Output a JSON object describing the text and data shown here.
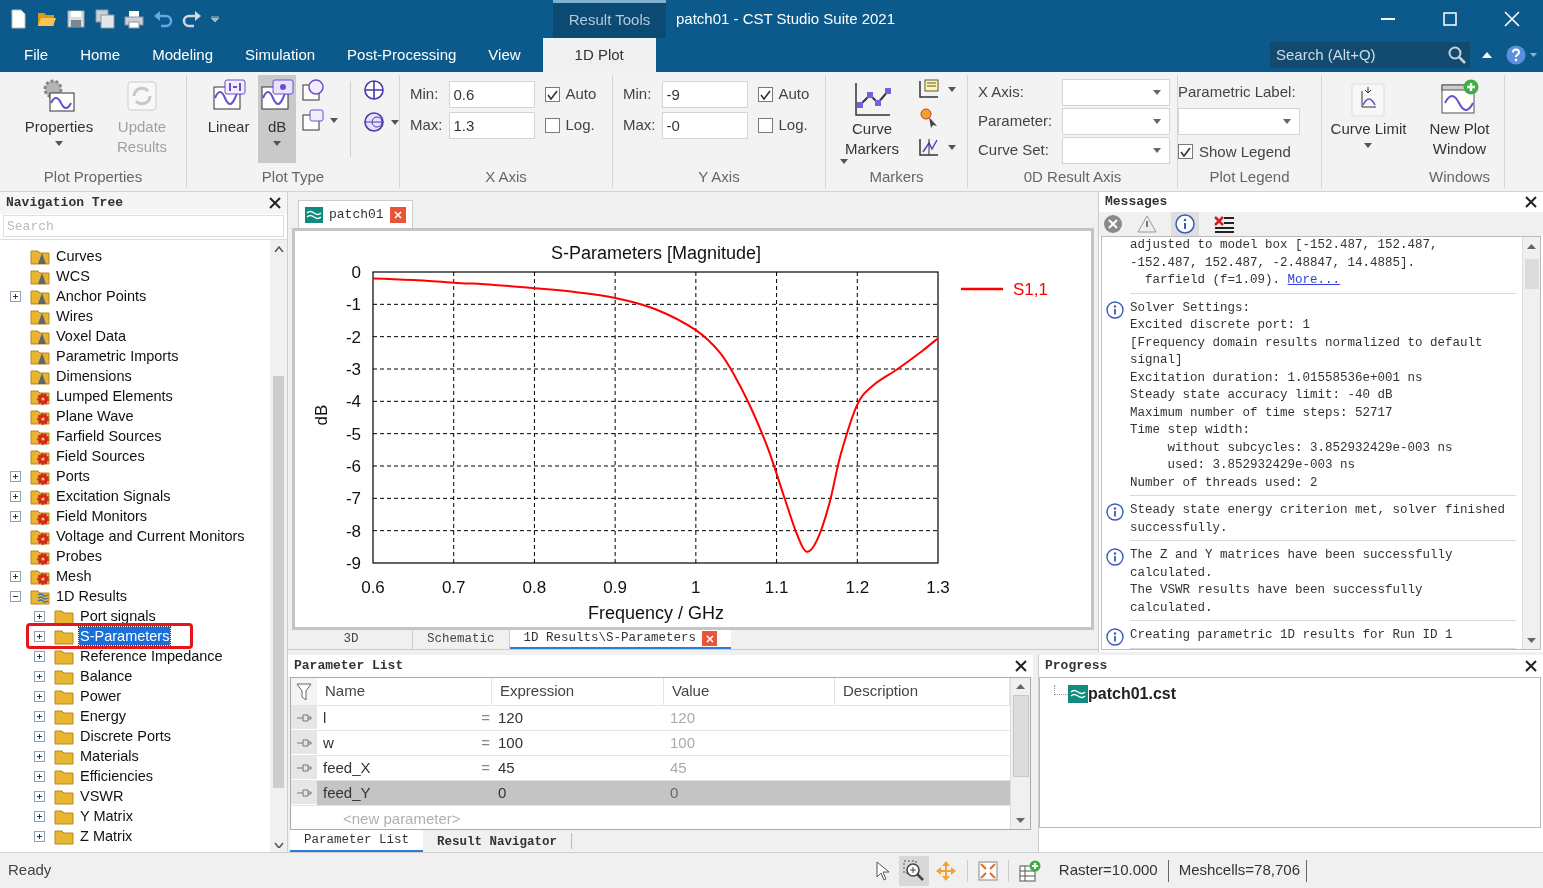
{
  "window": {
    "title": "patch01 - CST Studio Suite 2021",
    "context_tab": "Result Tools"
  },
  "ribbon_tabs": [
    {
      "label": "File",
      "selected": false
    },
    {
      "label": "Home",
      "selected": false
    },
    {
      "label": "Modeling",
      "selected": false
    },
    {
      "label": "Simulation",
      "selected": false
    },
    {
      "label": "Post-Processing",
      "selected": false
    },
    {
      "label": "View",
      "selected": false
    },
    {
      "label": "1D Plot",
      "selected": true
    }
  ],
  "search": {
    "placeholder": "Search (Alt+Q)"
  },
  "ribbon": {
    "plot_properties": {
      "label": "Plot Properties",
      "buttons": [
        {
          "label": "Properties",
          "disabled": false,
          "dropdown": true
        },
        {
          "label": "Update Results",
          "disabled": true,
          "dropdown": false
        }
      ]
    },
    "plot_type": {
      "label": "Plot Type",
      "buttons": [
        {
          "label": "Linear",
          "selected": false,
          "dropdown": false
        },
        {
          "label": "dB",
          "selected": true,
          "dropdown": true
        }
      ]
    },
    "x_axis": {
      "label": "X Axis",
      "min_label": "Min:",
      "min": "0.6",
      "max_label": "Max:",
      "max": "1.3",
      "auto": {
        "label": "Auto",
        "checked": true
      },
      "log": {
        "label": "Log.",
        "checked": false
      }
    },
    "y_axis": {
      "label": "Y Axis",
      "min_label": "Min:",
      "min": "-9",
      "max_label": "Max:",
      "max": "-0",
      "auto": {
        "label": "Auto",
        "checked": true
      },
      "log": {
        "label": "Log.",
        "checked": false
      }
    },
    "markers": {
      "label": "Markers",
      "button": "Curve Markers"
    },
    "result_axis": {
      "label": "0D Result Axis",
      "fields": [
        "X Axis:",
        "Parameter:",
        "Curve Set:"
      ]
    },
    "plot_legend": {
      "label": "Plot Legend",
      "parametric_label": "Parametric Label:",
      "show_legend": {
        "label": "Show Legend",
        "checked": true
      }
    },
    "curve_limit": {
      "button": "Curve Limit"
    },
    "windows": {
      "label": "Windows",
      "button": "New Plot Window"
    }
  },
  "navigation_tree": {
    "title": "Navigation Tree",
    "search_placeholder": "Search",
    "items": [
      {
        "label": "Curves",
        "kind": "model",
        "expandable": false,
        "selected": false,
        "outlined": false
      },
      {
        "label": "WCS",
        "kind": "model",
        "expandable": false,
        "selected": false,
        "outlined": false
      },
      {
        "label": "Anchor Points",
        "kind": "model",
        "expandable": true,
        "expanded": false,
        "selected": false,
        "outlined": false
      },
      {
        "label": "Wires",
        "kind": "model",
        "expandable": false,
        "selected": false,
        "outlined": false
      },
      {
        "label": "Voxel Data",
        "kind": "model",
        "expandable": false,
        "selected": false,
        "outlined": false
      },
      {
        "label": "Parametric Imports",
        "kind": "model",
        "expandable": false,
        "selected": false,
        "outlined": false
      },
      {
        "label": "Dimensions",
        "kind": "model",
        "expandable": false,
        "selected": false,
        "outlined": false
      },
      {
        "label": "Lumped Elements",
        "kind": "source",
        "expandable": false,
        "selected": false,
        "outlined": false
      },
      {
        "label": "Plane Wave",
        "kind": "source",
        "expandable": false,
        "selected": false,
        "outlined": false
      },
      {
        "label": "Farfield Sources",
        "kind": "source",
        "expandable": false,
        "selected": false,
        "outlined": false
      },
      {
        "label": "Field Sources",
        "kind": "source",
        "expandable": false,
        "selected": false,
        "outlined": false
      },
      {
        "label": "Ports",
        "kind": "source",
        "expandable": true,
        "expanded": false,
        "selected": false,
        "outlined": false
      },
      {
        "label": "Excitation Signals",
        "kind": "source",
        "expandable": true,
        "expanded": false,
        "selected": false,
        "outlined": false
      },
      {
        "label": "Field Monitors",
        "kind": "source",
        "expandable": true,
        "expanded": false,
        "selected": false,
        "outlined": false
      },
      {
        "label": "Voltage and Current Monitors",
        "kind": "source",
        "expandable": false,
        "selected": false,
        "outlined": false
      },
      {
        "label": "Probes",
        "kind": "source",
        "expandable": false,
        "selected": false,
        "outlined": false
      },
      {
        "label": "Mesh",
        "kind": "source",
        "expandable": true,
        "expanded": false,
        "selected": false,
        "outlined": false
      },
      {
        "label": "1D Results",
        "kind": "results",
        "expandable": true,
        "expanded": true,
        "selected": false,
        "outlined": false,
        "children": [
          {
            "label": "Port signals",
            "kind": "folder",
            "expandable": true,
            "expanded": false,
            "selected": false,
            "outlined": false
          },
          {
            "label": "S-Parameters",
            "kind": "folder",
            "expandable": true,
            "expanded": false,
            "selected": true,
            "outlined": true
          },
          {
            "label": "Reference Impedance",
            "kind": "folder",
            "expandable": true,
            "expanded": false,
            "selected": false,
            "outlined": false
          },
          {
            "label": "Balance",
            "kind": "folder",
            "expandable": true,
            "expanded": false,
            "selected": false,
            "outlined": false
          },
          {
            "label": "Power",
            "kind": "folder",
            "expandable": true,
            "expanded": false,
            "selected": false,
            "outlined": false
          },
          {
            "label": "Energy",
            "kind": "folder",
            "expandable": true,
            "expanded": false,
            "selected": false,
            "outlined": false
          },
          {
            "label": "Discrete Ports",
            "kind": "folder",
            "expandable": true,
            "expanded": false,
            "selected": false,
            "outlined": false
          },
          {
            "label": "Materials",
            "kind": "folder",
            "expandable": true,
            "expanded": false,
            "selected": false,
            "outlined": false
          },
          {
            "label": "Efficiencies",
            "kind": "folder",
            "expandable": true,
            "expanded": false,
            "selected": false,
            "outlined": false
          },
          {
            "label": "VSWR",
            "kind": "folder",
            "expandable": true,
            "expanded": false,
            "selected": false,
            "outlined": false
          },
          {
            "label": "Y Matrix",
            "kind": "folder",
            "expandable": true,
            "expanded": false,
            "selected": false,
            "outlined": false
          },
          {
            "label": "Z Matrix",
            "kind": "folder",
            "expandable": true,
            "expanded": false,
            "selected": false,
            "outlined": false
          }
        ]
      }
    ]
  },
  "document_tab": {
    "label": "patch01"
  },
  "plot": {
    "chart_data": {
      "type": "line",
      "title": "S-Parameters [Magnitude]",
      "xlabel": "Frequency / GHz",
      "ylabel": "dB",
      "grid": true,
      "x": [
        0.6,
        0.65,
        0.7,
        0.75,
        0.8,
        0.85,
        0.9,
        0.95,
        1.0,
        1.03,
        1.05,
        1.07,
        1.09,
        1.11,
        1.125,
        1.137,
        1.15,
        1.165,
        1.18,
        1.2,
        1.22,
        1.25,
        1.28,
        1.3
      ],
      "series": [
        {
          "name": "S1,1",
          "color": "#ff0000",
          "values": [
            -0.2,
            -0.25,
            -0.33,
            -0.4,
            -0.5,
            -0.62,
            -0.8,
            -1.15,
            -1.8,
            -2.5,
            -3.3,
            -4.3,
            -5.5,
            -7.0,
            -8.1,
            -8.65,
            -8.3,
            -7.2,
            -5.6,
            -4.1,
            -3.5,
            -3.0,
            -2.45,
            -2.05
          ]
        }
      ],
      "xlim": [
        0.6,
        1.3
      ],
      "ylim": [
        -9,
        0
      ],
      "xticks": [
        {
          "value": 0.6,
          "label": "0.6"
        },
        {
          "value": 0.7,
          "label": "0.7"
        },
        {
          "value": 0.8,
          "label": "0.8"
        },
        {
          "value": 0.9,
          "label": "0.9"
        },
        {
          "value": 1,
          "label": "1"
        },
        {
          "value": 1.1,
          "label": "1.1"
        },
        {
          "value": 1.2,
          "label": "1.2"
        },
        {
          "value": 1.3,
          "label": "1.3"
        }
      ],
      "yticks": [
        {
          "value": 0,
          "label": "0"
        },
        {
          "value": -1,
          "label": "-1"
        },
        {
          "value": -2,
          "label": "-2"
        },
        {
          "value": -3,
          "label": "-3"
        },
        {
          "value": -4,
          "label": "-4"
        },
        {
          "value": -5,
          "label": "-5"
        },
        {
          "value": -6,
          "label": "-6"
        },
        {
          "value": -7,
          "label": "-7"
        },
        {
          "value": -8,
          "label": "-8"
        },
        {
          "value": -9,
          "label": "-9"
        }
      ]
    }
  },
  "view_tabs": [
    {
      "label": "3D",
      "selected": false,
      "closable": false
    },
    {
      "label": "Schematic",
      "selected": false,
      "closable": false
    },
    {
      "label": "1D Results\\S-Parameters",
      "selected": true,
      "closable": true
    }
  ],
  "messages": {
    "title": "Messages",
    "entries": [
      {
        "kind": "none",
        "lines": [
          "adjusted to model box [-152.487, 152.487,",
          "-152.487, 152.487, -2.48847, 14.4885].",
          "  farfield (f=1.09)."
        ],
        "link": "More..."
      },
      {
        "kind": "info",
        "lines": [
          "Solver Settings:",
          "Excited discrete port: 1",
          "[Frequency domain results normalized to default",
          "signal]",
          "Excitation duration: 1.01558536e+001 ns",
          "Steady state accuracy limit: -40 dB",
          "Maximum number of time steps: 52717",
          "Time step width:",
          "     without subcycles: 3.852932429e-003 ns",
          "     used: 3.852932429e-003 ns",
          "Number of threads used: 2"
        ]
      },
      {
        "kind": "info",
        "lines": [
          "Steady state energy criterion met, solver finished",
          "successfully."
        ]
      },
      {
        "kind": "info",
        "lines": [
          "The Z and Y matrices have been successfully",
          "calculated.",
          "The VSWR results have been successfully",
          "calculated."
        ]
      },
      {
        "kind": "info",
        "lines": [
          "Creating parametric 1D results for Run ID 1"
        ]
      }
    ]
  },
  "parameter_list": {
    "title": "Parameter List",
    "columns": [
      "Name",
      "Expression",
      "Value",
      "Description"
    ],
    "rows": [
      {
        "name": "l",
        "operator": "=",
        "expression": "120",
        "value": "120",
        "selected": false
      },
      {
        "name": "w",
        "operator": "=",
        "expression": "100",
        "value": "100",
        "selected": false
      },
      {
        "name": "feed_X",
        "operator": "=",
        "expression": "45",
        "value": "45",
        "selected": false
      },
      {
        "name": "feed_Y",
        "expression": "0",
        "value": "0",
        "selected": true
      }
    ],
    "new_row": "<new parameter>",
    "tabs": [
      {
        "label": "Parameter List",
        "selected": true
      },
      {
        "label": "Result Navigator",
        "selected": false
      }
    ]
  },
  "progress": {
    "title": "Progress",
    "items": [
      {
        "label": "patch01.cst"
      }
    ]
  },
  "status_bar": {
    "text": "Ready",
    "raster": "Raster=10.000",
    "meshcells": "Meshcells=78,706"
  }
}
